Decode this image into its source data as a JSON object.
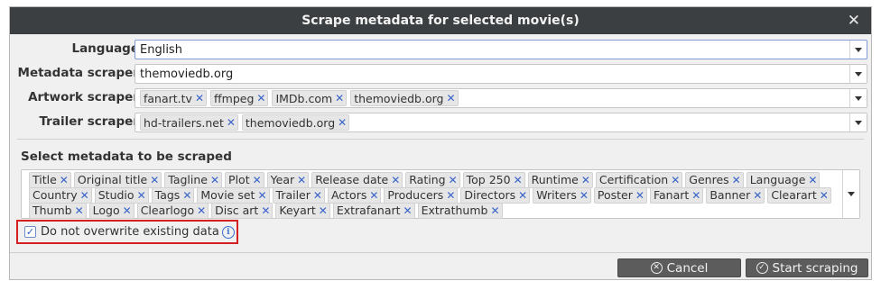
{
  "dialog": {
    "title": "Scrape metadata for selected movie(s)",
    "close_glyph": "✕"
  },
  "fields": {
    "language": {
      "label": "Language",
      "value": "English"
    },
    "metadata_scraper": {
      "label": "Metadata scraper",
      "value": "themoviedb.org"
    },
    "artwork_scraper": {
      "label": "Artwork scraper",
      "chips": [
        "fanart.tv",
        "ffmpeg",
        "IMDb.com",
        "themoviedb.org"
      ]
    },
    "trailer_scraper": {
      "label": "Trailer scraper",
      "chips": [
        "hd-trailers.net",
        "themoviedb.org"
      ]
    }
  },
  "metadata_section": {
    "label": "Select metadata to be scraped",
    "rows": [
      [
        "Title",
        "Original title",
        "Tagline",
        "Plot",
        "Year",
        "Release date",
        "Rating",
        "Top 250",
        "Runtime",
        "Certification",
        "Genres",
        "Language"
      ],
      [
        "Country",
        "Studio",
        "Tags",
        "Movie set",
        "Trailer",
        "Actors",
        "Producers",
        "Directors",
        "Writers",
        "Poster",
        "Fanart",
        "Banner",
        "Clearart"
      ],
      [
        "Thumb",
        "Logo",
        "Clearlogo",
        "Disc art",
        "Keyart",
        "Extrafanart",
        "Extrathumb"
      ]
    ]
  },
  "overwrite_checkbox": {
    "label": "Do not overwrite existing data",
    "checked": true,
    "info_glyph": "i"
  },
  "buttons": {
    "cancel": {
      "label": "Cancel",
      "icon": "cancel-circle-icon"
    },
    "start": {
      "label": "Start scraping",
      "icon": "check-circle-icon"
    }
  },
  "colors": {
    "titlebar": "#3c3f41",
    "chip_remove": "#3a63c9",
    "highlight_border": "#d42020",
    "button": "#5c5c5c"
  }
}
